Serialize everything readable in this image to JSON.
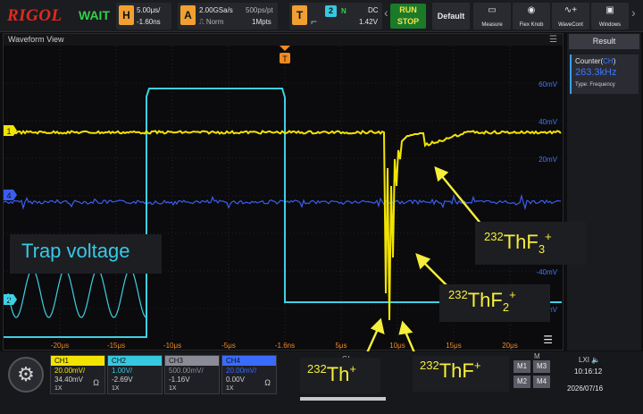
{
  "topbar": {
    "brand": "RIGOL",
    "acquire_state": "WAIT",
    "horizontal": {
      "tag": "H",
      "timebase": "5.00μs/",
      "offset": "-1.60ns"
    },
    "acquire": {
      "tag": "A",
      "sample_rate": "2.00GSa/s",
      "mode": "Norm",
      "resolution": "500ps/pt",
      "memory": "1Mpts"
    },
    "trigger": {
      "tag": "T",
      "channel": "2",
      "type": "N",
      "coupling": "DC",
      "level": "1.42V"
    },
    "run_stop_label": "RUN\nSTOP",
    "buttons": [
      "Default",
      "Measure",
      "Flex Knob",
      "WaveCont",
      "Windows"
    ]
  },
  "waveform_view": {
    "title": "Waveform View",
    "y_labels": [
      "60mV",
      "40mV",
      "20mV",
      "-40mV",
      "-60mV"
    ],
    "x_labels": [
      "-20μs",
      "-15μs",
      "-10μs",
      "-5μs",
      "-1.6ns",
      "5μs",
      "10μs",
      "15μs",
      "20μs"
    ],
    "channel_markers": [
      "1",
      "4",
      "2"
    ],
    "trigger_marker": "T"
  },
  "result": {
    "title": "Result",
    "counter_label": "Counter(",
    "counter_channel": "CH",
    "counter_close": ")",
    "counter_value": "263.3kHz",
    "type_label": "Type:",
    "type_value": "Frequency"
  },
  "channels": [
    {
      "name": "CH1",
      "scale": "20.00mV/",
      "offset": "34.40mV",
      "probe": "1X",
      "impedance": "Ω",
      "color": "#f2e400"
    },
    {
      "name": "CH2",
      "scale": "1.00V/",
      "offset": "-2.69V",
      "probe": "1X",
      "color": "#36c8e0"
    },
    {
      "name": "CH3",
      "scale": "500.00mV/",
      "offset": "-1.16V",
      "probe": "1X",
      "color": "#8a8b94"
    },
    {
      "name": "CH4",
      "scale": "20.00mV/",
      "offset": "0.00V",
      "probe": "1X",
      "impedance": "Ω",
      "color": "#3a6bff"
    }
  ],
  "bottombar": {
    "math": [
      "M1",
      "M3",
      "M2",
      "M4"
    ],
    "math_header": "M",
    "gi_label": "GI",
    "l_label": "L",
    "time": "10:16:12",
    "date": "2026/07/16",
    "status": "LXI"
  },
  "annotations": {
    "trap_voltage": "Trap voltage",
    "thf3": {
      "mass": "232",
      "text": "ThF",
      "sub": "3",
      "charge": "+"
    },
    "thf2": {
      "mass": "232",
      "text": "ThF",
      "sub": "2",
      "charge": "+"
    },
    "th": {
      "mass": "232",
      "text": "Th",
      "charge": "+"
    },
    "thf": {
      "mass": "232",
      "text": "ThF",
      "charge": "+"
    }
  }
}
